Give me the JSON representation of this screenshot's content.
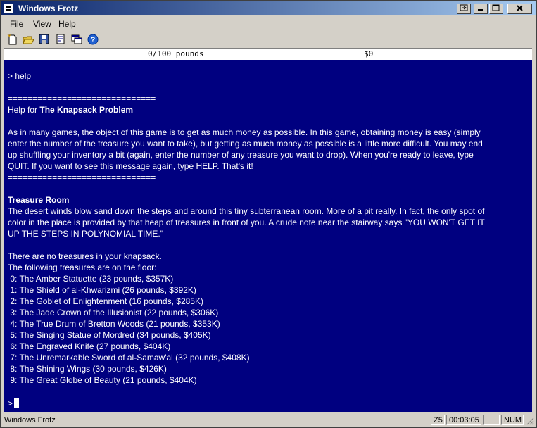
{
  "window": {
    "title": "Windows Frotz"
  },
  "menu": [
    "File",
    "View",
    "Help"
  ],
  "toolbar": {
    "icons": [
      "new-icon",
      "open-icon",
      "save-icon",
      "properties-icon",
      "windows-icon",
      "help-icon"
    ]
  },
  "status_line": {
    "left": "0/100 pounds",
    "right": "$0"
  },
  "game": {
    "command": "> help",
    "rule": "==============================",
    "help_prefix": "Help for ",
    "help_title": "The Knapsack Problem",
    "help_text": [
      "As in many games, the object of this game is to get as much money as possible. In this game, obtaining money is easy (simply",
      "enter the number of the treasure you want to take), but getting as much money as possible is a little more difficult. You may end",
      "up shuffling your inventory a bit (again, enter the number of any treasure you want to drop). When you're ready to leave, type",
      "QUIT. If you want to see this message again, type HELP. That's it!"
    ],
    "room_title": "Treasure Room",
    "room_text": [
      "The desert winds blow sand down the steps and around this tiny subterranean room. More of a pit really. In fact, the only spot of",
      "color in the place is provided by that heap of treasures in front of you. A crude note near the stairway says \"YOU WON'T GET IT",
      "UP THE STEPS IN POLYNOMIAL TIME.\""
    ],
    "knapsack_text": "There are no treasures in your knapsack.",
    "floor_text": "The following treasures are on the floor:",
    "treasures": [
      " 0: The Amber Statuette (23 pounds, $357K)",
      " 1: The Shield of al-Khwarizmi (26 pounds, $392K)",
      " 2: The Goblet of Enlightenment (16 pounds, $285K)",
      " 3: The Jade Crown of the Illusionist (22 pounds, $306K)",
      " 4: The True Drum of Bretton Woods (21 pounds, $353K)",
      " 5: The Singing Statue of Mordred (34 pounds, $405K)",
      " 6: The Engraved Knife (27 pounds, $404K)",
      " 7: The Unremarkable Sword of al-Samaw'al (32 pounds, $408K)",
      " 8: The Shining Wings (30 pounds, $426K)",
      " 9: The Great Globe of Beauty (21 pounds, $404K)"
    ],
    "prompt": ">"
  },
  "statusbar": {
    "text": "Windows Frotz",
    "version": "Z5",
    "time": "00:03:05",
    "num": "NUM"
  },
  "colors": {
    "screen_bg": "#000080",
    "screen_fg": "#ffffff",
    "title_start": "#0a246a",
    "title_end": "#a6caf0"
  }
}
